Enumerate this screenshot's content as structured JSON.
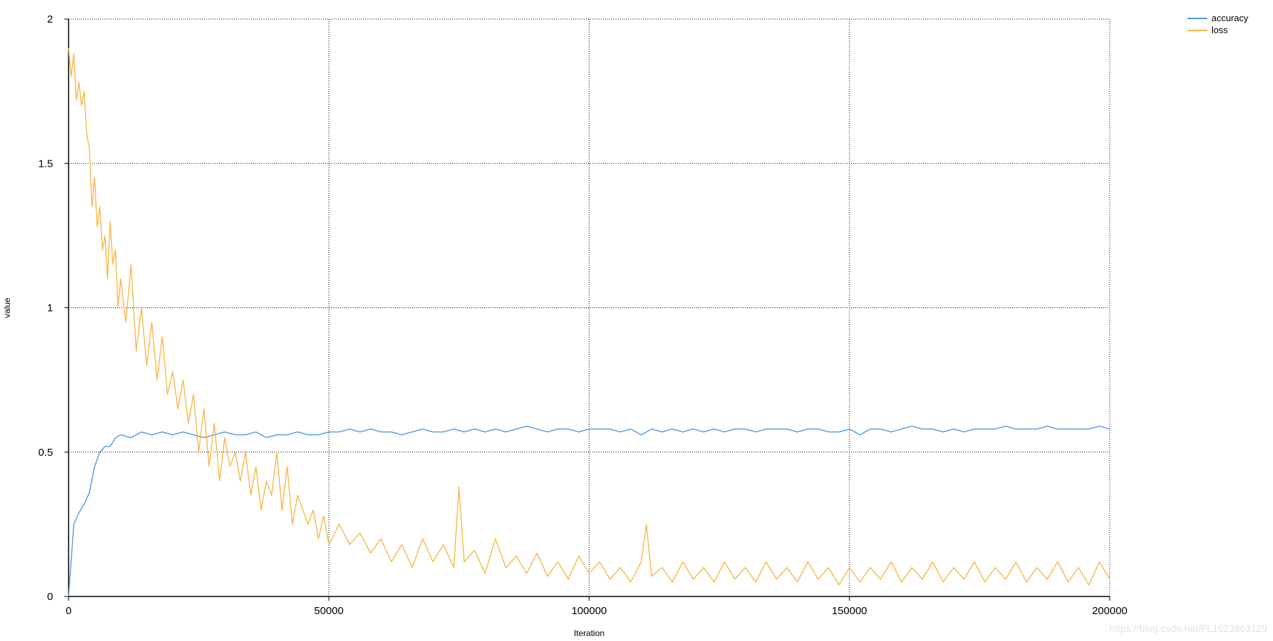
{
  "chart_data": {
    "type": "line",
    "xlabel": "Iteration",
    "ylabel": "value",
    "xlim": [
      0,
      200000
    ],
    "ylim": [
      0,
      2
    ],
    "x_ticks": [
      0,
      50000,
      100000,
      150000,
      200000
    ],
    "y_ticks": [
      0,
      0.5,
      1,
      1.5,
      2
    ],
    "x_tick_labels": [
      "0",
      "50000",
      "100000",
      "150000",
      "200000"
    ],
    "y_tick_labels": [
      "0",
      "0.5",
      "1",
      "1.5",
      "2"
    ],
    "grid": true,
    "legend_position": "top-right",
    "series": [
      {
        "name": "accuracy",
        "color": "#4c9be8",
        "points": [
          [
            0,
            0
          ],
          [
            1000,
            0.25
          ],
          [
            2000,
            0.29
          ],
          [
            3000,
            0.32
          ],
          [
            4000,
            0.36
          ],
          [
            5000,
            0.45
          ],
          [
            6000,
            0.5
          ],
          [
            7000,
            0.52
          ],
          [
            8000,
            0.52
          ],
          [
            9000,
            0.55
          ],
          [
            10000,
            0.56
          ],
          [
            12000,
            0.55
          ],
          [
            14000,
            0.57
          ],
          [
            16000,
            0.56
          ],
          [
            18000,
            0.57
          ],
          [
            20000,
            0.56
          ],
          [
            22000,
            0.57
          ],
          [
            24000,
            0.56
          ],
          [
            26000,
            0.55
          ],
          [
            28000,
            0.56
          ],
          [
            30000,
            0.57
          ],
          [
            32000,
            0.56
          ],
          [
            34000,
            0.56
          ],
          [
            36000,
            0.57
          ],
          [
            38000,
            0.55
          ],
          [
            40000,
            0.56
          ],
          [
            42000,
            0.56
          ],
          [
            44000,
            0.57
          ],
          [
            46000,
            0.56
          ],
          [
            48000,
            0.56
          ],
          [
            50000,
            0.57
          ],
          [
            52000,
            0.57
          ],
          [
            54000,
            0.58
          ],
          [
            56000,
            0.57
          ],
          [
            58000,
            0.58
          ],
          [
            60000,
            0.57
          ],
          [
            62000,
            0.57
          ],
          [
            64000,
            0.56
          ],
          [
            66000,
            0.57
          ],
          [
            68000,
            0.58
          ],
          [
            70000,
            0.57
          ],
          [
            72000,
            0.57
          ],
          [
            74000,
            0.58
          ],
          [
            76000,
            0.57
          ],
          [
            78000,
            0.58
          ],
          [
            80000,
            0.57
          ],
          [
            82000,
            0.58
          ],
          [
            84000,
            0.57
          ],
          [
            86000,
            0.58
          ],
          [
            88000,
            0.59
          ],
          [
            90000,
            0.58
          ],
          [
            92000,
            0.57
          ],
          [
            94000,
            0.58
          ],
          [
            96000,
            0.58
          ],
          [
            98000,
            0.57
          ],
          [
            100000,
            0.58
          ],
          [
            102000,
            0.58
          ],
          [
            104000,
            0.58
          ],
          [
            106000,
            0.57
          ],
          [
            108000,
            0.58
          ],
          [
            110000,
            0.56
          ],
          [
            112000,
            0.58
          ],
          [
            114000,
            0.57
          ],
          [
            116000,
            0.58
          ],
          [
            118000,
            0.57
          ],
          [
            120000,
            0.58
          ],
          [
            122000,
            0.57
          ],
          [
            124000,
            0.58
          ],
          [
            126000,
            0.57
          ],
          [
            128000,
            0.58
          ],
          [
            130000,
            0.58
          ],
          [
            132000,
            0.57
          ],
          [
            134000,
            0.58
          ],
          [
            136000,
            0.58
          ],
          [
            138000,
            0.58
          ],
          [
            140000,
            0.57
          ],
          [
            142000,
            0.58
          ],
          [
            144000,
            0.58
          ],
          [
            146000,
            0.57
          ],
          [
            148000,
            0.57
          ],
          [
            150000,
            0.58
          ],
          [
            152000,
            0.56
          ],
          [
            154000,
            0.58
          ],
          [
            156000,
            0.58
          ],
          [
            158000,
            0.57
          ],
          [
            160000,
            0.58
          ],
          [
            162000,
            0.59
          ],
          [
            164000,
            0.58
          ],
          [
            166000,
            0.58
          ],
          [
            168000,
            0.57
          ],
          [
            170000,
            0.58
          ],
          [
            172000,
            0.57
          ],
          [
            174000,
            0.58
          ],
          [
            176000,
            0.58
          ],
          [
            178000,
            0.58
          ],
          [
            180000,
            0.59
          ],
          [
            182000,
            0.58
          ],
          [
            184000,
            0.58
          ],
          [
            186000,
            0.58
          ],
          [
            188000,
            0.59
          ],
          [
            190000,
            0.58
          ],
          [
            192000,
            0.58
          ],
          [
            194000,
            0.58
          ],
          [
            196000,
            0.58
          ],
          [
            198000,
            0.59
          ],
          [
            200000,
            0.58
          ]
        ]
      },
      {
        "name": "loss",
        "color": "#f7b84b",
        "points": [
          [
            0,
            1.9
          ],
          [
            500,
            1.8
          ],
          [
            1000,
            1.88
          ],
          [
            1500,
            1.72
          ],
          [
            2000,
            1.78
          ],
          [
            2500,
            1.7
          ],
          [
            3000,
            1.75
          ],
          [
            3500,
            1.6
          ],
          [
            4000,
            1.55
          ],
          [
            4500,
            1.35
          ],
          [
            5000,
            1.45
          ],
          [
            5500,
            1.28
          ],
          [
            6000,
            1.35
          ],
          [
            6500,
            1.2
          ],
          [
            7000,
            1.25
          ],
          [
            7500,
            1.1
          ],
          [
            8000,
            1.3
          ],
          [
            8500,
            1.15
          ],
          [
            9000,
            1.2
          ],
          [
            9500,
            1.0
          ],
          [
            10000,
            1.1
          ],
          [
            11000,
            0.95
          ],
          [
            12000,
            1.15
          ],
          [
            13000,
            0.85
          ],
          [
            14000,
            1.0
          ],
          [
            15000,
            0.8
          ],
          [
            16000,
            0.95
          ],
          [
            17000,
            0.75
          ],
          [
            18000,
            0.9
          ],
          [
            19000,
            0.7
          ],
          [
            20000,
            0.78
          ],
          [
            21000,
            0.65
          ],
          [
            22000,
            0.75
          ],
          [
            23000,
            0.6
          ],
          [
            24000,
            0.7
          ],
          [
            25000,
            0.5
          ],
          [
            26000,
            0.65
          ],
          [
            27000,
            0.45
          ],
          [
            28000,
            0.6
          ],
          [
            29000,
            0.4
          ],
          [
            30000,
            0.55
          ],
          [
            31000,
            0.45
          ],
          [
            32000,
            0.5
          ],
          [
            33000,
            0.4
          ],
          [
            34000,
            0.5
          ],
          [
            35000,
            0.35
          ],
          [
            36000,
            0.45
          ],
          [
            37000,
            0.3
          ],
          [
            38000,
            0.4
          ],
          [
            39000,
            0.35
          ],
          [
            40000,
            0.5
          ],
          [
            41000,
            0.3
          ],
          [
            42000,
            0.45
          ],
          [
            43000,
            0.25
          ],
          [
            44000,
            0.35
          ],
          [
            45000,
            0.3
          ],
          [
            46000,
            0.25
          ],
          [
            47000,
            0.3
          ],
          [
            48000,
            0.2
          ],
          [
            49000,
            0.28
          ],
          [
            50000,
            0.18
          ],
          [
            52000,
            0.25
          ],
          [
            54000,
            0.18
          ],
          [
            56000,
            0.22
          ],
          [
            58000,
            0.15
          ],
          [
            60000,
            0.2
          ],
          [
            62000,
            0.12
          ],
          [
            64000,
            0.18
          ],
          [
            66000,
            0.1
          ],
          [
            68000,
            0.2
          ],
          [
            70000,
            0.12
          ],
          [
            72000,
            0.18
          ],
          [
            74000,
            0.1
          ],
          [
            75000,
            0.38
          ],
          [
            76000,
            0.12
          ],
          [
            78000,
            0.16
          ],
          [
            80000,
            0.08
          ],
          [
            82000,
            0.2
          ],
          [
            84000,
            0.1
          ],
          [
            86000,
            0.14
          ],
          [
            88000,
            0.08
          ],
          [
            90000,
            0.15
          ],
          [
            92000,
            0.07
          ],
          [
            94000,
            0.12
          ],
          [
            96000,
            0.06
          ],
          [
            98000,
            0.14
          ],
          [
            100000,
            0.08
          ],
          [
            102000,
            0.12
          ],
          [
            104000,
            0.06
          ],
          [
            106000,
            0.1
          ],
          [
            108000,
            0.05
          ],
          [
            110000,
            0.12
          ],
          [
            111000,
            0.25
          ],
          [
            112000,
            0.07
          ],
          [
            114000,
            0.1
          ],
          [
            116000,
            0.05
          ],
          [
            118000,
            0.12
          ],
          [
            120000,
            0.06
          ],
          [
            122000,
            0.1
          ],
          [
            124000,
            0.05
          ],
          [
            126000,
            0.12
          ],
          [
            128000,
            0.06
          ],
          [
            130000,
            0.1
          ],
          [
            132000,
            0.05
          ],
          [
            134000,
            0.12
          ],
          [
            136000,
            0.06
          ],
          [
            138000,
            0.1
          ],
          [
            140000,
            0.05
          ],
          [
            142000,
            0.12
          ],
          [
            144000,
            0.06
          ],
          [
            146000,
            0.1
          ],
          [
            148000,
            0.04
          ],
          [
            150000,
            0.1
          ],
          [
            152000,
            0.05
          ],
          [
            154000,
            0.1
          ],
          [
            156000,
            0.06
          ],
          [
            158000,
            0.12
          ],
          [
            160000,
            0.05
          ],
          [
            162000,
            0.1
          ],
          [
            164000,
            0.06
          ],
          [
            166000,
            0.12
          ],
          [
            168000,
            0.05
          ],
          [
            170000,
            0.1
          ],
          [
            172000,
            0.06
          ],
          [
            174000,
            0.12
          ],
          [
            176000,
            0.05
          ],
          [
            178000,
            0.1
          ],
          [
            180000,
            0.06
          ],
          [
            182000,
            0.12
          ],
          [
            184000,
            0.05
          ],
          [
            186000,
            0.1
          ],
          [
            188000,
            0.06
          ],
          [
            190000,
            0.12
          ],
          [
            192000,
            0.05
          ],
          [
            194000,
            0.1
          ],
          [
            196000,
            0.04
          ],
          [
            198000,
            0.12
          ],
          [
            200000,
            0.06
          ]
        ]
      }
    ]
  },
  "watermark": "https://blog.csdn.net/FL1623863129"
}
